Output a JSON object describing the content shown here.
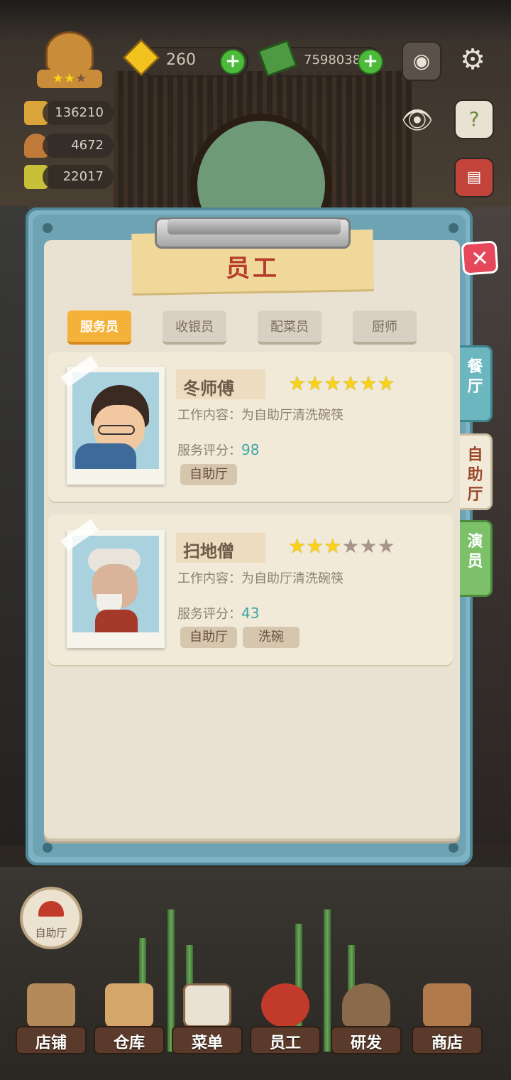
{
  "hud": {
    "gems": "260",
    "cash": "7598038",
    "stat_1": "136210",
    "stat_2": "4672",
    "stat_3": "22017",
    "rank_stars": 3
  },
  "panel": {
    "title": "员工",
    "tabs": [
      "服务员",
      "收银员",
      "配菜员",
      "厨师"
    ],
    "active_tab": 0,
    "side_tabs": [
      "餐\n厅",
      "自\n助\n厅",
      "演\n员"
    ],
    "active_side_tab": 1
  },
  "staff": [
    {
      "name": "冬师傅",
      "stars": 6,
      "max_stars": 6,
      "work_label": "工作内容：",
      "work": "为自助厅清洗碗筷",
      "score_label": "服务评分：",
      "score": "98",
      "tags": [
        "自助厅"
      ]
    },
    {
      "name": "扫地僧",
      "stars": 3,
      "max_stars": 6,
      "work_label": "工作内容：",
      "work": "为自助厅清洗碗筷",
      "score_label": "服务评分：",
      "score": "43",
      "tags": [
        "自助厅",
        "洗碗"
      ]
    }
  ],
  "venue_button": "自助厅",
  "bottom_nav": [
    "店铺",
    "仓库",
    "菜单",
    "员工",
    "研发",
    "商店"
  ],
  "colors": {
    "active_tab": "#f5b23a",
    "side_tab_restaurant": "#6bb6bf",
    "side_tab_buffet": "#f1ead9",
    "side_tab_actor": "#7cc16a",
    "close": "#e5485a",
    "title": "#b53c2a"
  }
}
